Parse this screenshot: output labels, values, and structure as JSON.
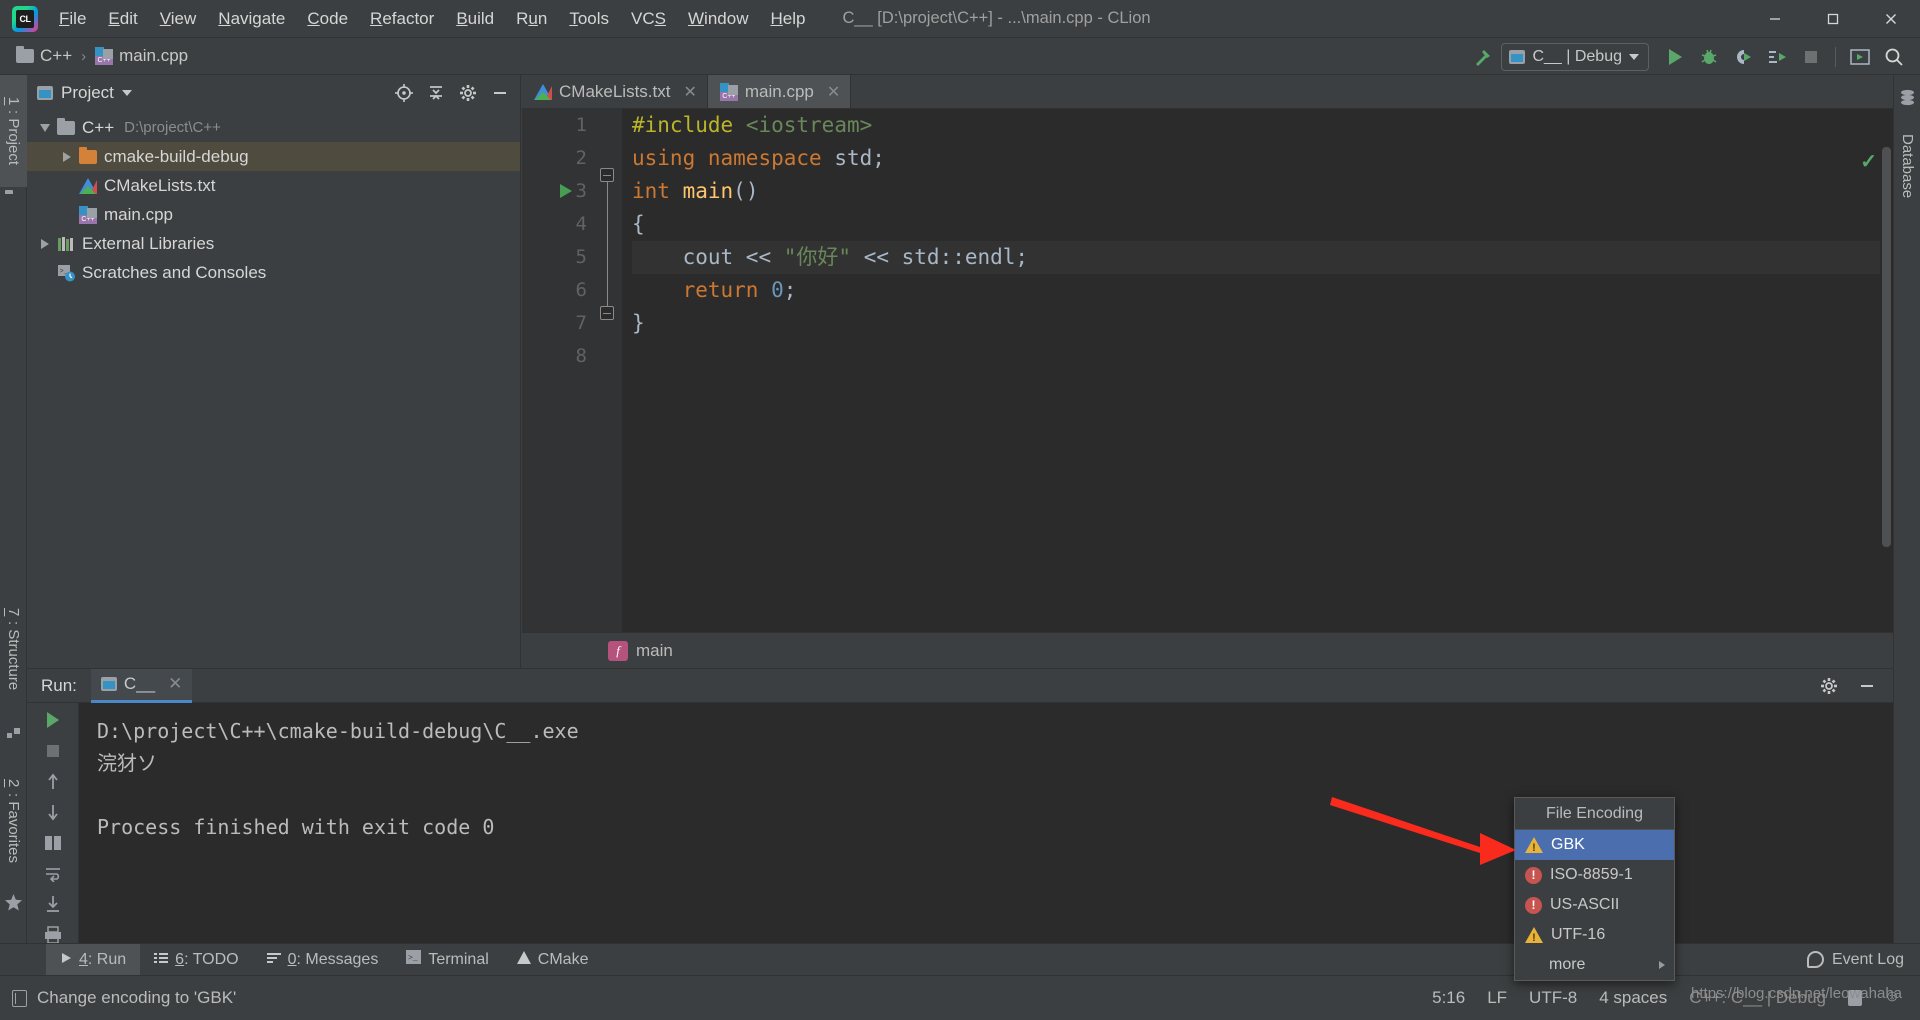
{
  "window": {
    "title": "C__ [D:\\project\\C++] - ...\\main.cpp - CLion",
    "logo_icon": "clion-logo-icon",
    "minimize_label": "—",
    "maximize_label": "□",
    "close_label": "✕"
  },
  "menu": {
    "items": [
      {
        "label": "File",
        "mnemonic": "F",
        "rest": "ile"
      },
      {
        "label": "Edit",
        "mnemonic": "E",
        "rest": "dit"
      },
      {
        "label": "View",
        "mnemonic": "V",
        "rest": "iew"
      },
      {
        "label": "Navigate",
        "mnemonic": "N",
        "rest": "avigate"
      },
      {
        "label": "Code",
        "mnemonic": "C",
        "rest": "ode"
      },
      {
        "label": "Refactor",
        "mnemonic": "R",
        "rest": "efactor"
      },
      {
        "label": "Build",
        "mnemonic": "B",
        "rest": "uild"
      },
      {
        "label": "Run",
        "mnemonic": "R",
        "rest": "un"
      },
      {
        "label": "Tools",
        "mnemonic": "T",
        "rest": "ools"
      },
      {
        "label": "VCS",
        "mnemonic": "S",
        "rest": "VCS"
      },
      {
        "label": "Window",
        "mnemonic": "W",
        "rest": "indow"
      },
      {
        "label": "Help",
        "mnemonic": "H",
        "rest": "elp"
      }
    ]
  },
  "navbar": {
    "crumb_project": "C++",
    "crumb_separator": "›",
    "crumb_file": "main.cpp",
    "build_icon": "hammer-icon",
    "run_config": "C__ | Debug",
    "run_icon": "run-icon",
    "debug_icon": "debug-bug-icon",
    "coverage_icon": "run-with-coverage-icon",
    "profile_icon": "profile-icon",
    "stop_icon": "stop-icon",
    "updates_icon": "update-app-icon",
    "search_icon": "search-everywhere-icon"
  },
  "left_rail": {
    "project_tab": "1: Project",
    "project_mnemonic": "1",
    "project_rest": ": Project",
    "structure_tab": "7: Structure",
    "structure_mnemonic": "7",
    "structure_rest": ": Structure",
    "favorites_tab": "2: Favorites",
    "favorites_mnemonic": "2",
    "favorites_rest": ": Favorites"
  },
  "right_rail": {
    "database_tab": "Database"
  },
  "project_panel": {
    "title": "Project",
    "locate_icon": "locate-target-icon",
    "collapse_icon": "collapse-all-icon",
    "settings_icon": "gear-icon",
    "hide_icon": "hide-panel-icon",
    "tree": [
      {
        "label": "C++",
        "sub": "D:\\project\\C++",
        "icon": "folder-gray-icon",
        "arrow": "down",
        "indent": 0,
        "selected": false
      },
      {
        "label": "cmake-build-debug",
        "sub": "",
        "icon": "folder-orange-icon",
        "arrow": "right",
        "indent": 1,
        "selected": true
      },
      {
        "label": "CMakeLists.txt",
        "sub": "",
        "icon": "cmake-file-icon",
        "arrow": "none",
        "indent": 1,
        "selected": false
      },
      {
        "label": "main.cpp",
        "sub": "",
        "icon": "cpp-file-icon",
        "arrow": "none",
        "indent": 1,
        "selected": false
      },
      {
        "label": "External Libraries",
        "sub": "",
        "icon": "libraries-icon",
        "arrow": "right",
        "indent": 0,
        "selected": false
      },
      {
        "label": "Scratches and Consoles",
        "sub": "",
        "icon": "scratches-icon",
        "arrow": "none",
        "indent": 0,
        "selected": false
      }
    ]
  },
  "editor": {
    "tabs": [
      {
        "label": "CMakeLists.txt",
        "icon": "cmake-file-icon",
        "active": false,
        "close": "✕"
      },
      {
        "label": "main.cpp",
        "icon": "cpp-file-icon",
        "active": true,
        "close": "✕"
      }
    ],
    "line_numbers": [
      "1",
      "2",
      "3",
      "4",
      "5",
      "6",
      "7",
      "8"
    ],
    "code_lines": [
      {
        "n": 1,
        "tokens": [
          {
            "t": "#include",
            "c": "k-pre"
          },
          {
            "t": " ",
            "c": "k-plain"
          },
          {
            "t": "<iostream>",
            "c": "k-inc"
          }
        ],
        "current": false
      },
      {
        "n": 2,
        "tokens": [
          {
            "t": "using",
            "c": "k-kw"
          },
          {
            "t": " ",
            "c": "k-plain"
          },
          {
            "t": "namespace",
            "c": "k-kw"
          },
          {
            "t": " ",
            "c": "k-plain"
          },
          {
            "t": "std",
            "c": "k-plain"
          },
          {
            "t": ";",
            "c": "k-plain"
          }
        ],
        "current": false
      },
      {
        "n": 3,
        "tokens": [
          {
            "t": "int",
            "c": "k-kw"
          },
          {
            "t": " ",
            "c": "k-plain"
          },
          {
            "t": "main",
            "c": "k-fn"
          },
          {
            "t": "()",
            "c": "k-plain"
          }
        ],
        "current": false
      },
      {
        "n": 4,
        "tokens": [
          {
            "t": "{",
            "c": "k-plain"
          }
        ],
        "current": false
      },
      {
        "n": 5,
        "tokens": [
          {
            "t": "    cout ",
            "c": "k-plain"
          },
          {
            "t": "<<",
            "c": "k-op"
          },
          {
            "t": " ",
            "c": "k-plain"
          },
          {
            "t": "\"你好\"",
            "c": "k-str"
          },
          {
            "t": " ",
            "c": "k-plain"
          },
          {
            "t": "<<",
            "c": "k-op"
          },
          {
            "t": " std::endl;",
            "c": "k-plain"
          }
        ],
        "current": true
      },
      {
        "n": 6,
        "tokens": [
          {
            "t": "    ",
            "c": "k-plain"
          },
          {
            "t": "return",
            "c": "k-kw"
          },
          {
            "t": " ",
            "c": "k-plain"
          },
          {
            "t": "0",
            "c": "k-num"
          },
          {
            "t": ";",
            "c": "k-plain"
          }
        ],
        "current": false
      },
      {
        "n": 7,
        "tokens": [
          {
            "t": "}",
            "c": "k-plain"
          }
        ],
        "current": false
      },
      {
        "n": 8,
        "tokens": [
          {
            "t": "",
            "c": "k-plain"
          }
        ],
        "current": false
      }
    ],
    "gutter_run_line": 3,
    "inspection_status": "✓",
    "breadcrumb_function": "main",
    "breadcrumb_function_icon": "function-icon"
  },
  "run_panel": {
    "title": "Run:",
    "tab_label": "C__",
    "tab_icon": "run-config-icon",
    "tab_close": "✕",
    "settings_icon": "gear-icon",
    "hide_icon": "hide-panel-icon",
    "toolbar_icons": [
      "rerun-icon",
      "stop-icon",
      "layout-icon",
      "print-icon",
      "trash-icon"
    ],
    "console_lines": [
      "D:\\project\\C++\\cmake-build-debug\\C__.exe",
      "浣犲ソ",
      "",
      "Process finished with exit code 0"
    ]
  },
  "popup": {
    "header": "File Encoding",
    "items": [
      {
        "label": "GBK",
        "status": "warning",
        "selected": true
      },
      {
        "label": "ISO-8859-1",
        "status": "error",
        "selected": false
      },
      {
        "label": "US-ASCII",
        "status": "error",
        "selected": false
      },
      {
        "label": "UTF-16",
        "status": "warning",
        "selected": false
      },
      {
        "label": "more",
        "status": "none",
        "selected": false,
        "submenu": true
      }
    ]
  },
  "bottom_tabs": {
    "items": [
      {
        "label": "4: Run",
        "mnemonic": "4",
        "rest": ": Run",
        "icon": "run-icon",
        "active": true
      },
      {
        "label": "6: TODO",
        "mnemonic": "6",
        "rest": ": TODO",
        "icon": "todo-icon",
        "active": false
      },
      {
        "label": "0: Messages",
        "mnemonic": "0",
        "rest": ": Messages",
        "icon": "messages-icon",
        "active": false
      },
      {
        "label": "Terminal",
        "mnemonic": "",
        "rest": "Terminal",
        "icon": "terminal-icon",
        "active": false
      },
      {
        "label": "CMake",
        "mnemonic": "",
        "rest": "CMake",
        "icon": "cmake-icon",
        "active": false
      }
    ],
    "event_log": "Event Log",
    "event_log_icon": "event-log-icon"
  },
  "statusbar": {
    "message": "Change encoding to 'GBK'",
    "message_icon": "document-icon",
    "caret": "5:16",
    "line_separator": "LF",
    "encoding": "UTF-8",
    "indent": "4 spaces",
    "config": "C++: C__ | Debug",
    "lock_icon": "lock-icon",
    "face_icon": "face-icon"
  },
  "watermark": {
    "text": "https://blog.csdn.net/leowahaha"
  },
  "colors": {
    "accent_blue": "#4b6eaf",
    "panel_bg": "#3c3f41",
    "editor_bg": "#2b2b2b",
    "selected_row": "#4f4b3f",
    "green": "#59a869",
    "warning": "#e8b33a",
    "error": "#c75450",
    "annotation_arrow": "#ff2b1f"
  }
}
